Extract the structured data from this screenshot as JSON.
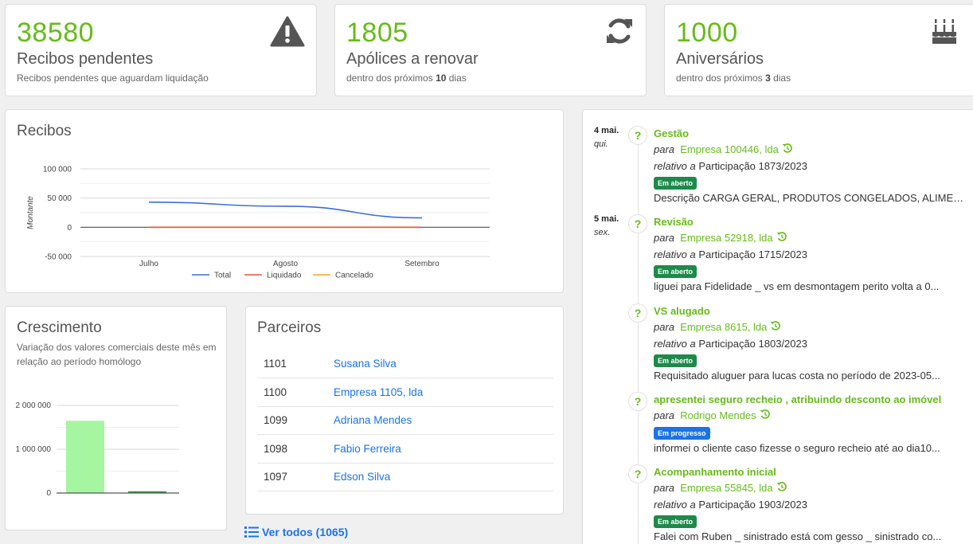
{
  "stats": [
    {
      "number": "38580",
      "title": "Recibos pendentes",
      "sub_pre": "Recibos pendentes que aguardam liquidação",
      "sub_bold": "",
      "sub_post": "",
      "icon": "warning-icon"
    },
    {
      "number": "1805",
      "title": "Apólices a renovar",
      "sub_pre": "dentro dos próximos ",
      "sub_bold": "10",
      "sub_post": " dias",
      "icon": "refresh-icon"
    },
    {
      "number": "1000",
      "title": "Aniversários",
      "sub_pre": "dentro dos próximos ",
      "sub_bold": "3",
      "sub_post": " dias",
      "icon": "birthday-cake-icon"
    }
  ],
  "recibos": {
    "title": "Recibos",
    "chart_data": {
      "type": "line",
      "categories": [
        "Julho",
        "Agosto",
        "Setembro"
      ],
      "series": [
        {
          "name": "Total",
          "color": "#3d6fd8",
          "values": [
            43000,
            36000,
            16000
          ]
        },
        {
          "name": "Liquidado",
          "color": "#e8523a",
          "values": [
            0,
            0,
            0
          ]
        },
        {
          "name": "Cancelado",
          "color": "#f5a623",
          "values": [
            0,
            0,
            0
          ]
        }
      ],
      "ylabel": "Montante",
      "yticks": [
        100000,
        50000,
        0,
        -50000
      ],
      "ytick_labels": [
        "100 000",
        "50 000",
        "0",
        "-50 000"
      ],
      "ylim": [
        -50000,
        100000
      ],
      "legend": "bottom",
      "grid": true
    }
  },
  "crescimento": {
    "title": "Crescimento",
    "subtitle": "Variação dos valores comerciais deste mês em relação ao período homólogo",
    "chart_data": {
      "type": "bar",
      "categories": [
        "",
        ""
      ],
      "values": [
        1650000,
        40000
      ],
      "colors": [
        "#a6f5a0",
        "#2e9e3a"
      ],
      "yticks": [
        2000000,
        1000000,
        0
      ],
      "ytick_labels": [
        "2 000 000",
        "1 000 000",
        "0"
      ],
      "ylim": [
        0,
        2000000
      ]
    }
  },
  "parceiros": {
    "title": "Parceiros",
    "rows": [
      {
        "id": "1101",
        "name": "Susana Silva"
      },
      {
        "id": "1100",
        "name": "Empresa 1105, lda"
      },
      {
        "id": "1099",
        "name": "Adriana Mendes"
      },
      {
        "id": "1098",
        "name": "Fabio Ferreira"
      },
      {
        "id": "1097",
        "name": "Edson Silva"
      }
    ],
    "ver_todos": "Ver todos (1065)"
  },
  "timeline": [
    {
      "date": "4 mai.",
      "day": "qui.",
      "title": "Gestão",
      "para": "para",
      "target": "Empresa 100446, lda",
      "relativo": "relativo a",
      "ref": "Participação 1873/2023",
      "badge": "Em aberto",
      "badge_color": "green",
      "desc": "Descrição CARGA GERAL, PRODUTOS CONGELADOS, ALIMENTOS"
    },
    {
      "date": "5 mai.",
      "day": "sex.",
      "title": "Revisão",
      "para": "para",
      "target": "Empresa 52918, lda",
      "relativo": "relativo a",
      "ref": "Participação 1715/2023",
      "badge": "Em aberto",
      "badge_color": "green",
      "desc": "liguei para Fidelidade _ vs em desmontagem perito volta a 0..."
    },
    {
      "date": "",
      "day": "",
      "title": "VS alugado",
      "para": "para",
      "target": "Empresa 8615, lda",
      "relativo": "relativo a",
      "ref": "Participação 1803/2023",
      "badge": "Em aberto",
      "badge_color": "green",
      "desc": "Requisitado aluguer para lucas costa no período de 2023-05..."
    },
    {
      "date": "",
      "day": "",
      "title": "apresentei seguro recheio , atribuindo desconto ao imóvel",
      "para": "para",
      "target": "Rodrigo Mendes",
      "relativo": "",
      "ref": "",
      "badge": "Em progresso",
      "badge_color": "blue",
      "desc": "informei o cliente caso fizesse o seguro recheio até ao dia10..."
    },
    {
      "date": "",
      "day": "",
      "title": "Acompanhamento inicial",
      "para": "para",
      "target": "Empresa 55845, lda",
      "relativo": "relativo a",
      "ref": "Participação 1903/2023",
      "badge": "Em aberto",
      "badge_color": "green",
      "desc": "Falei com Ruben _ sinistrado está com gesso _ sinistrado co..."
    }
  ]
}
